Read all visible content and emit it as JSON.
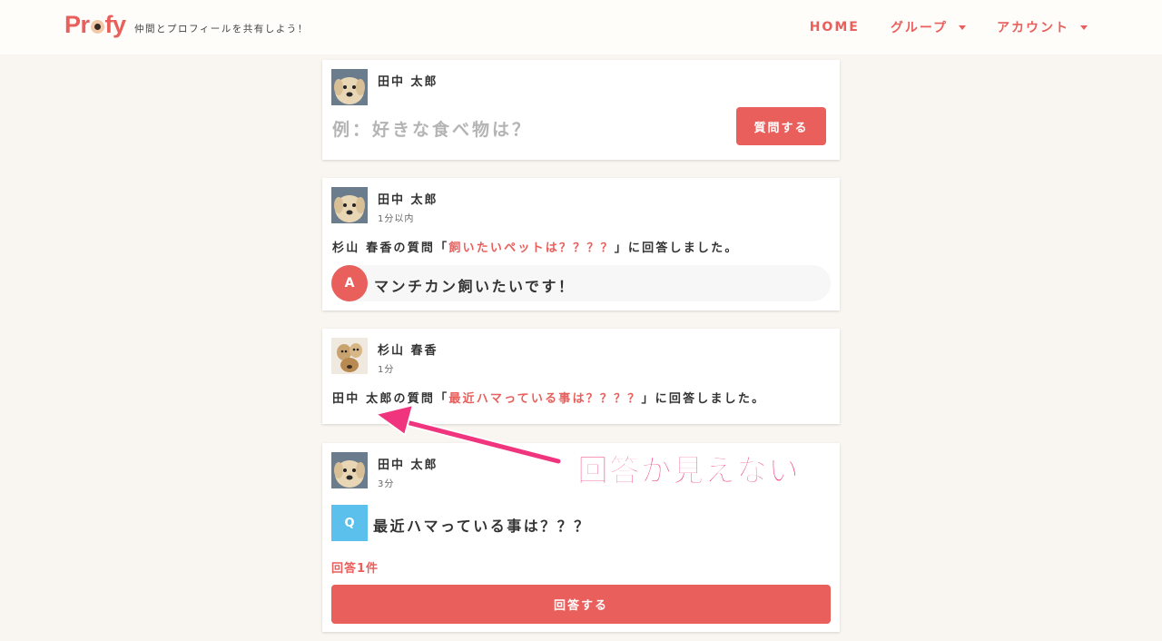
{
  "header": {
    "logo": {
      "p": "Pr",
      "rest": "fy"
    },
    "tagline": "仲間とプロフィールを共有しよう！",
    "nav": [
      {
        "label": "HOME",
        "dropdown": false
      },
      {
        "label": "グループ",
        "dropdown": true
      },
      {
        "label": "アカウント",
        "dropdown": true
      }
    ]
  },
  "compose": {
    "user_name": "田中 太郎",
    "placeholder": "例：好きな食べ物は？",
    "submit_label": "質問する"
  },
  "feed": [
    {
      "user_name": "田中 太郎",
      "time": "1分以内",
      "sentence": {
        "prefix": "杉山 春香の質問「",
        "link": "飼いたいペットは？？？？",
        "suffix": "」に回答しました。"
      },
      "answer_badge": "A",
      "answer": "マンチカン飼いたいです！"
    },
    {
      "user_name": "杉山 春香",
      "time": "1分",
      "sentence": {
        "prefix": "田中 太郎の質問「",
        "link": "最近ハマっている事は？？？？",
        "suffix": "」に回答しました。"
      }
    },
    {
      "user_name": "田中 太郎",
      "time": "3分",
      "question_badge": "Q",
      "question": "最近ハマっている事は？？？",
      "answer_count": "回答1件",
      "answer_button": "回答する"
    }
  ],
  "annotation": {
    "text": "回答が見えない",
    "color": "#f0347e"
  },
  "colors": {
    "accent": "#e85f5c",
    "question_badge": "#5bc0eb",
    "background": "#f9f6f1"
  }
}
